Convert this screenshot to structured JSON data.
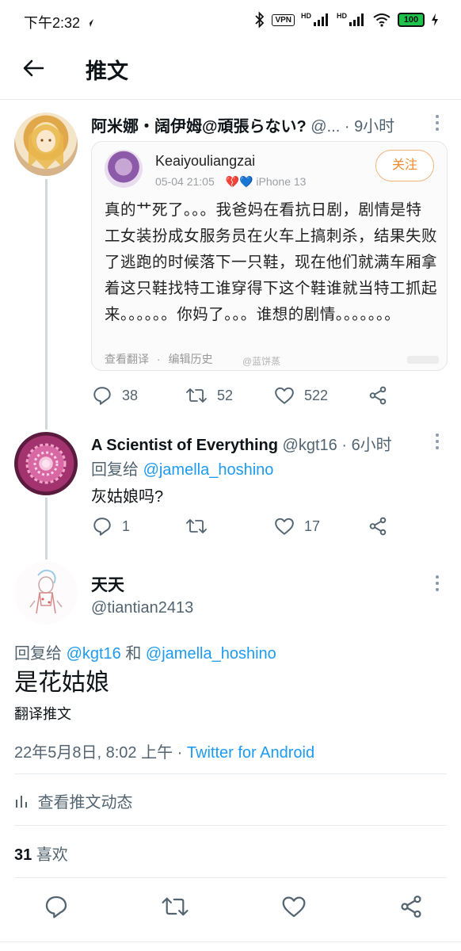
{
  "status_bar": {
    "time": "下午2:32",
    "vpn": "VPN",
    "hd1": "HD",
    "hd2": "HD",
    "battery": "100"
  },
  "header": {
    "title": "推文"
  },
  "tweet1": {
    "name": "阿米娜・阔伊姆@頑張らない?",
    "handle": "@...",
    "time": "9小时",
    "card": {
      "author": "Keaiyouliangzai",
      "date": "05-04 21:05",
      "device": "iPhone 13",
      "follow_label": "关注",
      "text": "真的艹死了。。。我爸妈在看抗日剧，剧情是特工女装扮成女服务员在火车上搞刺杀，结果失败了逃跑的时候落下一只鞋，现在他们就满车厢拿着这只鞋找特工谁穿得下这个鞋谁就当特工抓起来。。。。。。你妈了。。。谁想的剧情。。。。。。。",
      "translate": "查看翻译",
      "separator": "·",
      "edit_history": "编辑历史",
      "watermark": "@蓝饼蒸"
    },
    "replies": "38",
    "retweets": "52",
    "likes": "522"
  },
  "tweet2": {
    "name": "A Scientist of Everything",
    "handle": "@kgt16",
    "time": "6小时",
    "reply_prefix": "回复给",
    "reply_to": "@jamella_hoshino",
    "text": "灰姑娘吗?",
    "replies": "1",
    "retweets": "",
    "likes": "17"
  },
  "main_tweet": {
    "name": "天天",
    "handle": "@tiantian2413",
    "reply_prefix": "回复给",
    "reply_to_1": "@kgt16",
    "reply_and": "和",
    "reply_to_2": "@jamella_hoshino",
    "text": "是花姑娘",
    "translate": "翻译推文",
    "timestamp": "22年5月8日, 8:02 上午",
    "dot": "·",
    "client": "Twitter for Android",
    "activity": "查看推文动态",
    "likes_count": "31",
    "likes_label": "喜欢"
  },
  "colors": {
    "link_blue": "#1d9bf0",
    "secondary_gray": "#536471",
    "divider": "#e6ecf0",
    "follow_orange": "#ee8a2e"
  },
  "icons": [
    "back-arrow-icon",
    "reply-icon",
    "retweet-icon",
    "like-icon",
    "share-icon",
    "more-icon",
    "analytics-icon",
    "bluetooth-icon",
    "signal-icon",
    "wifi-icon",
    "battery-icon"
  ]
}
